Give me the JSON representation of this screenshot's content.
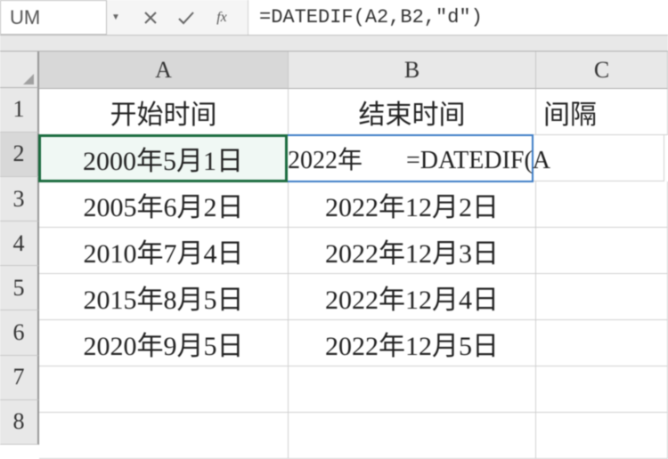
{
  "formula_bar": {
    "name_box": "UM",
    "cancel_tooltip": "Cancel",
    "enter_tooltip": "Enter",
    "fx_label": "fx",
    "formula": "=DATEDIF(A2,B2,\"d\")"
  },
  "columns": [
    "A",
    "B",
    "C"
  ],
  "row_headers": [
    "1",
    "2",
    "3",
    "4",
    "5",
    "6",
    "7",
    "8"
  ],
  "grid": {
    "header_row": {
      "A": "开始时间",
      "B": "结束时间",
      "C": "间隔"
    },
    "rows": [
      {
        "A": "2000年5月1日",
        "B": "2022年",
        "C_overflow": "=DATEDIF(A"
      },
      {
        "A": "2005年6月2日",
        "B": "2022年12月2日",
        "C": ""
      },
      {
        "A": "2010年7月4日",
        "B": "2022年12月3日",
        "C": ""
      },
      {
        "A": "2015年8月5日",
        "B": "2022年12月4日",
        "C": ""
      },
      {
        "A": "2020年9月5日",
        "B": "2022年12月5日",
        "C": ""
      }
    ]
  },
  "active_cell": "A2",
  "ref_cell": "B2"
}
